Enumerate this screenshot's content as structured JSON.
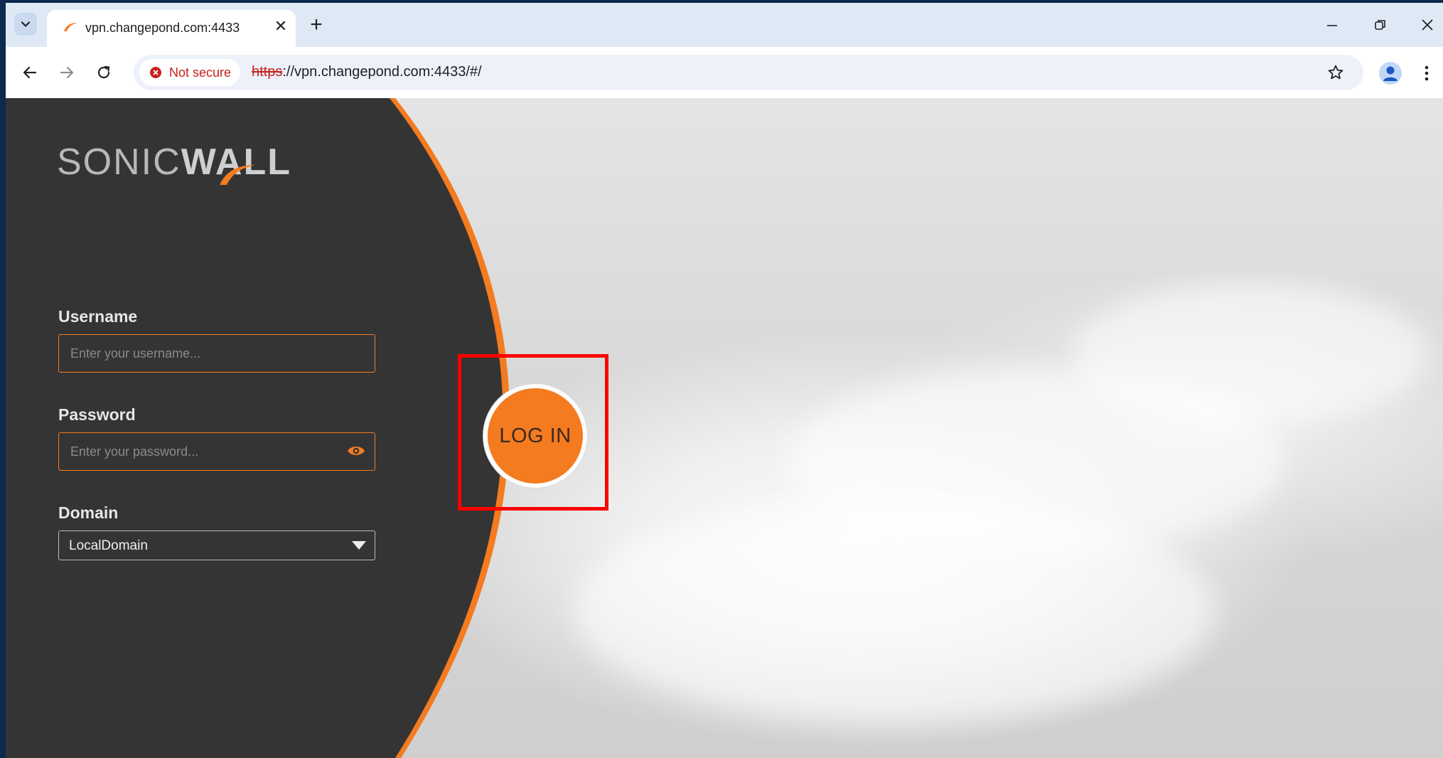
{
  "browser": {
    "tab": {
      "title": "vpn.changepond.com:4433",
      "favicon": "sonicwall-swoosh-icon"
    },
    "security_chip": "Not secure",
    "url": {
      "scheme": "https",
      "rest": "://vpn.changepond.com:4433/#/"
    }
  },
  "page": {
    "logo": {
      "part1": "SONIC",
      "part2": "WALL"
    },
    "username": {
      "label": "Username",
      "placeholder": "Enter your username..."
    },
    "password": {
      "label": "Password",
      "placeholder": "Enter your password..."
    },
    "domain": {
      "label": "Domain",
      "value": "LocalDomain"
    },
    "login_button": "LOG IN"
  },
  "colors": {
    "accent": "#f47b20",
    "panel": "#343434",
    "highlight": "#ff0000"
  }
}
